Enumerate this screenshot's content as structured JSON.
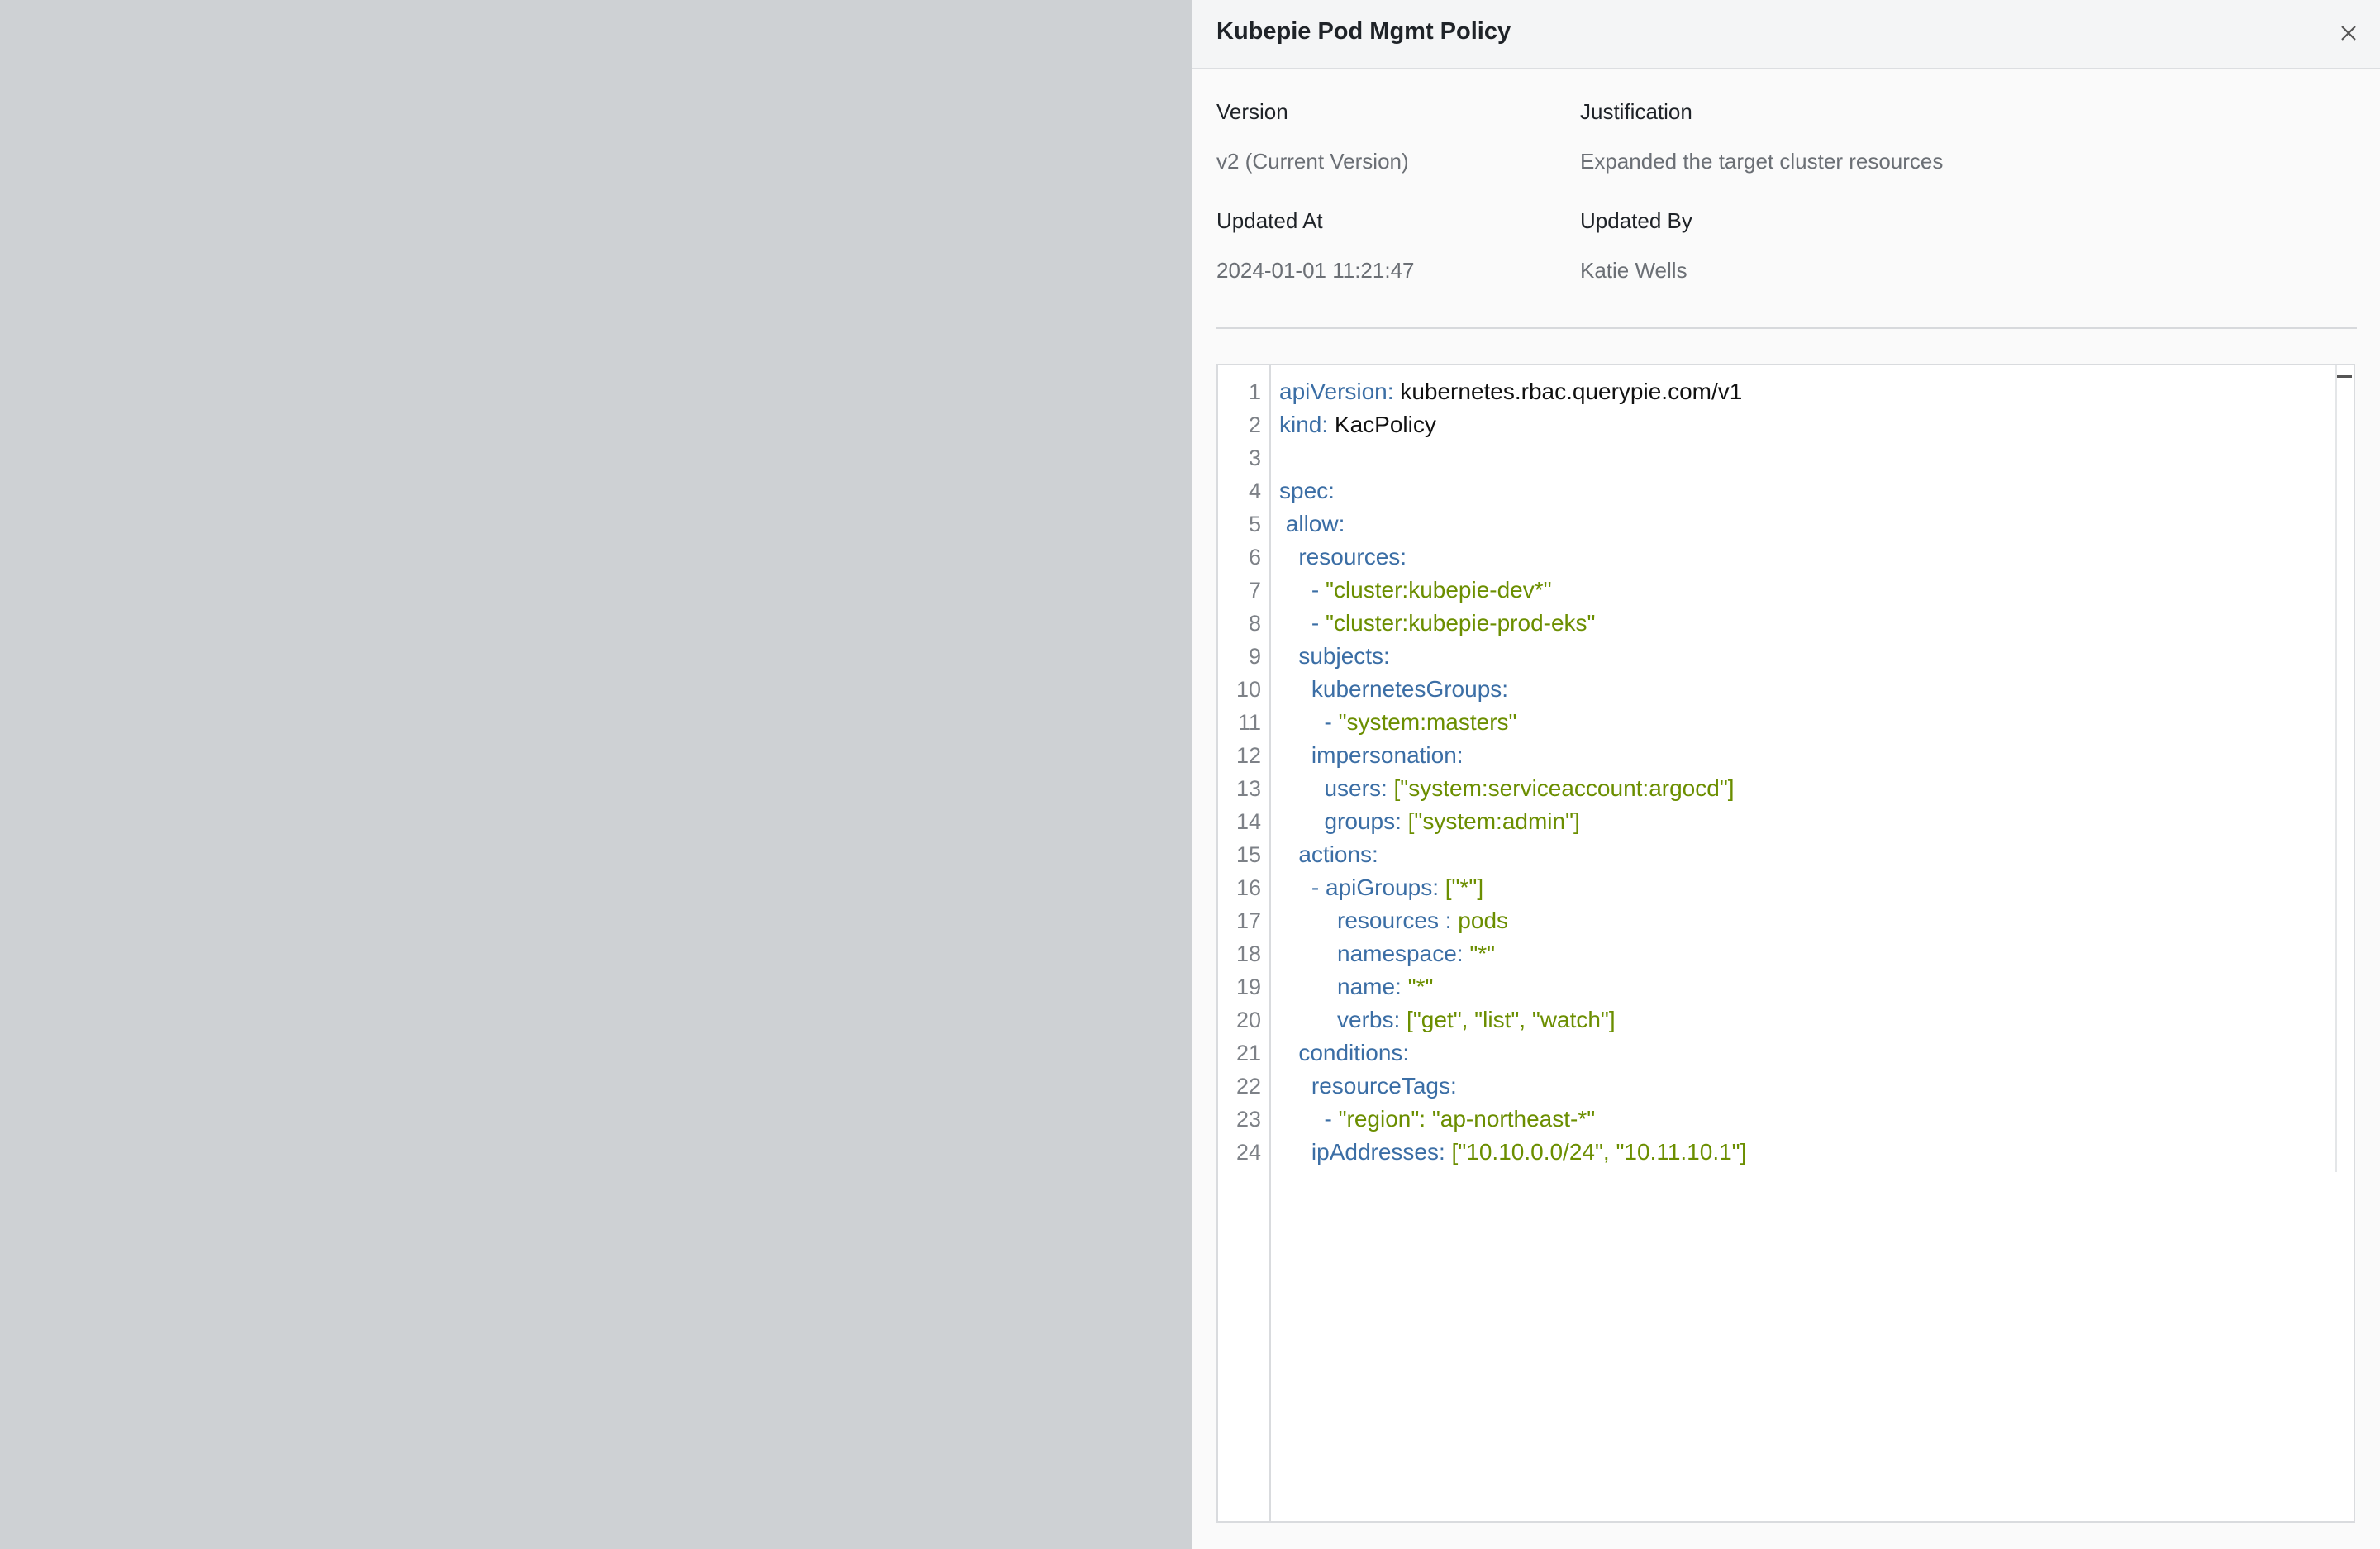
{
  "drawer": {
    "title": "Kubepie Pod Mgmt Policy",
    "close_icon": "close-icon"
  },
  "meta": {
    "version_label": "Version",
    "version_value": "v2 (Current Version)",
    "justification_label": "Justification",
    "justification_value": "Expanded the target cluster resources",
    "updated_at_label": "Updated At",
    "updated_at_value": "2024-01-01 11:21:47",
    "updated_by_label": "Updated By",
    "updated_by_value": "Katie Wells"
  },
  "editor": {
    "lines": [
      {
        "n": "1",
        "indent": "",
        "key": "apiVersion:",
        "val": " kubernetes.rbac.querypie.com/v1",
        "type": "v"
      },
      {
        "n": "2",
        "indent": "",
        "key": "kind:",
        "val": " KacPolicy",
        "type": "v"
      },
      {
        "n": "3",
        "indent": "",
        "key": "",
        "val": "",
        "type": "v"
      },
      {
        "n": "4",
        "indent": "",
        "key": "spec:",
        "val": "",
        "type": "v"
      },
      {
        "n": "5",
        "indent": " ",
        "key": "allow:",
        "val": "",
        "type": "v"
      },
      {
        "n": "6",
        "indent": "   ",
        "key": "resources:",
        "val": "",
        "type": "v"
      },
      {
        "n": "7",
        "indent": "     ",
        "key": "- ",
        "val": "\"cluster:kubepie-dev*\"",
        "type": "s"
      },
      {
        "n": "8",
        "indent": "     ",
        "key": "- ",
        "val": "\"cluster:kubepie-prod-eks\"",
        "type": "s"
      },
      {
        "n": "9",
        "indent": "   ",
        "key": "subjects:",
        "val": "",
        "type": "v"
      },
      {
        "n": "10",
        "indent": "     ",
        "key": "kubernetesGroups:",
        "val": "",
        "type": "v"
      },
      {
        "n": "11",
        "indent": "       ",
        "key": "- ",
        "val": "\"system:masters\"",
        "type": "s"
      },
      {
        "n": "12",
        "indent": "     ",
        "key": "impersonation:",
        "val": "",
        "type": "v"
      },
      {
        "n": "13",
        "indent": "       ",
        "key": "users:",
        "val": " [\"system:serviceaccount:argocd\"]",
        "type": "s"
      },
      {
        "n": "14",
        "indent": "       ",
        "key": "groups:",
        "val": " [\"system:admin\"]",
        "type": "s"
      },
      {
        "n": "15",
        "indent": "   ",
        "key": "actions:",
        "val": "",
        "type": "v"
      },
      {
        "n": "16",
        "indent": "     ",
        "key": "- apiGroups:",
        "val": " [\"*\"]",
        "type": "s"
      },
      {
        "n": "17",
        "indent": "         ",
        "key": "resources :",
        "val": " pods",
        "type": "s"
      },
      {
        "n": "18",
        "indent": "         ",
        "key": "namespace:",
        "val": " \"*\"",
        "type": "s"
      },
      {
        "n": "19",
        "indent": "         ",
        "key": "name:",
        "val": " \"*\"",
        "type": "s"
      },
      {
        "n": "20",
        "indent": "         ",
        "key": "verbs:",
        "val": " [\"get\", \"list\", \"watch\"]",
        "type": "s"
      },
      {
        "n": "21",
        "indent": "   ",
        "key": "conditions:",
        "val": "",
        "type": "v"
      },
      {
        "n": "22",
        "indent": "     ",
        "key": "resourceTags:",
        "val": "",
        "type": "v"
      },
      {
        "n": "23",
        "indent": "       ",
        "key": "- ",
        "val": "\"region\": \"ap-northeast-*\"",
        "type": "s"
      },
      {
        "n": "24",
        "indent": "     ",
        "key": "ipAddresses:",
        "val": " [\"10.10.0.0/24\", \"10.11.10.1\"]",
        "type": "s"
      }
    ]
  },
  "colors": {
    "overlay": "#ced1d4",
    "key": "#3b6ea5",
    "string": "#6b8e00",
    "plain": "#111111"
  }
}
